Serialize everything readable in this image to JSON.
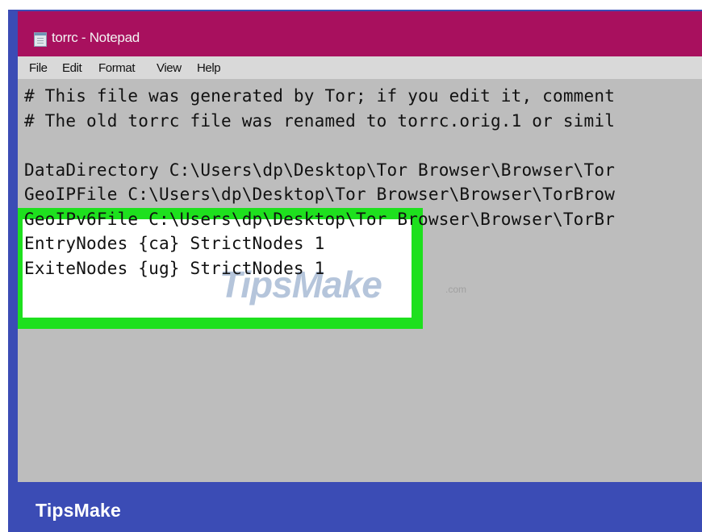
{
  "window": {
    "title": "torrc - Notepad",
    "icon": "notepad-icon"
  },
  "menu": [
    {
      "label": "File"
    },
    {
      "label": "Edit"
    },
    {
      "label": "Format"
    },
    {
      "label": "View"
    },
    {
      "label": "Help"
    }
  ],
  "editor": {
    "lines": [
      "# This file was generated by Tor; if you edit it, comment",
      "# The old torrc file was renamed to torrc.orig.1 or simil",
      "",
      "DataDirectory C:\\Users\\dp\\Desktop\\Tor Browser\\Browser\\Tor",
      "GeoIPFile C:\\Users\\dp\\Desktop\\Tor Browser\\Browser\\TorBrow",
      "GeoIPv6File C:\\Users\\dp\\Desktop\\Tor Browser\\Browser\\TorBr",
      "EntryNodes {ca} StrictNodes 1",
      "ExiteNodes {ug} StrictNodes 1"
    ]
  },
  "watermark": {
    "text": "TipsMake",
    "suffix": ".com"
  },
  "footer": {
    "brand": "TipsMake"
  },
  "colors": {
    "frame": "#3b4cb5",
    "titlebar": "#a8105e",
    "highlight": "#1ee01e",
    "editor_bg": "#bdbdbd"
  }
}
